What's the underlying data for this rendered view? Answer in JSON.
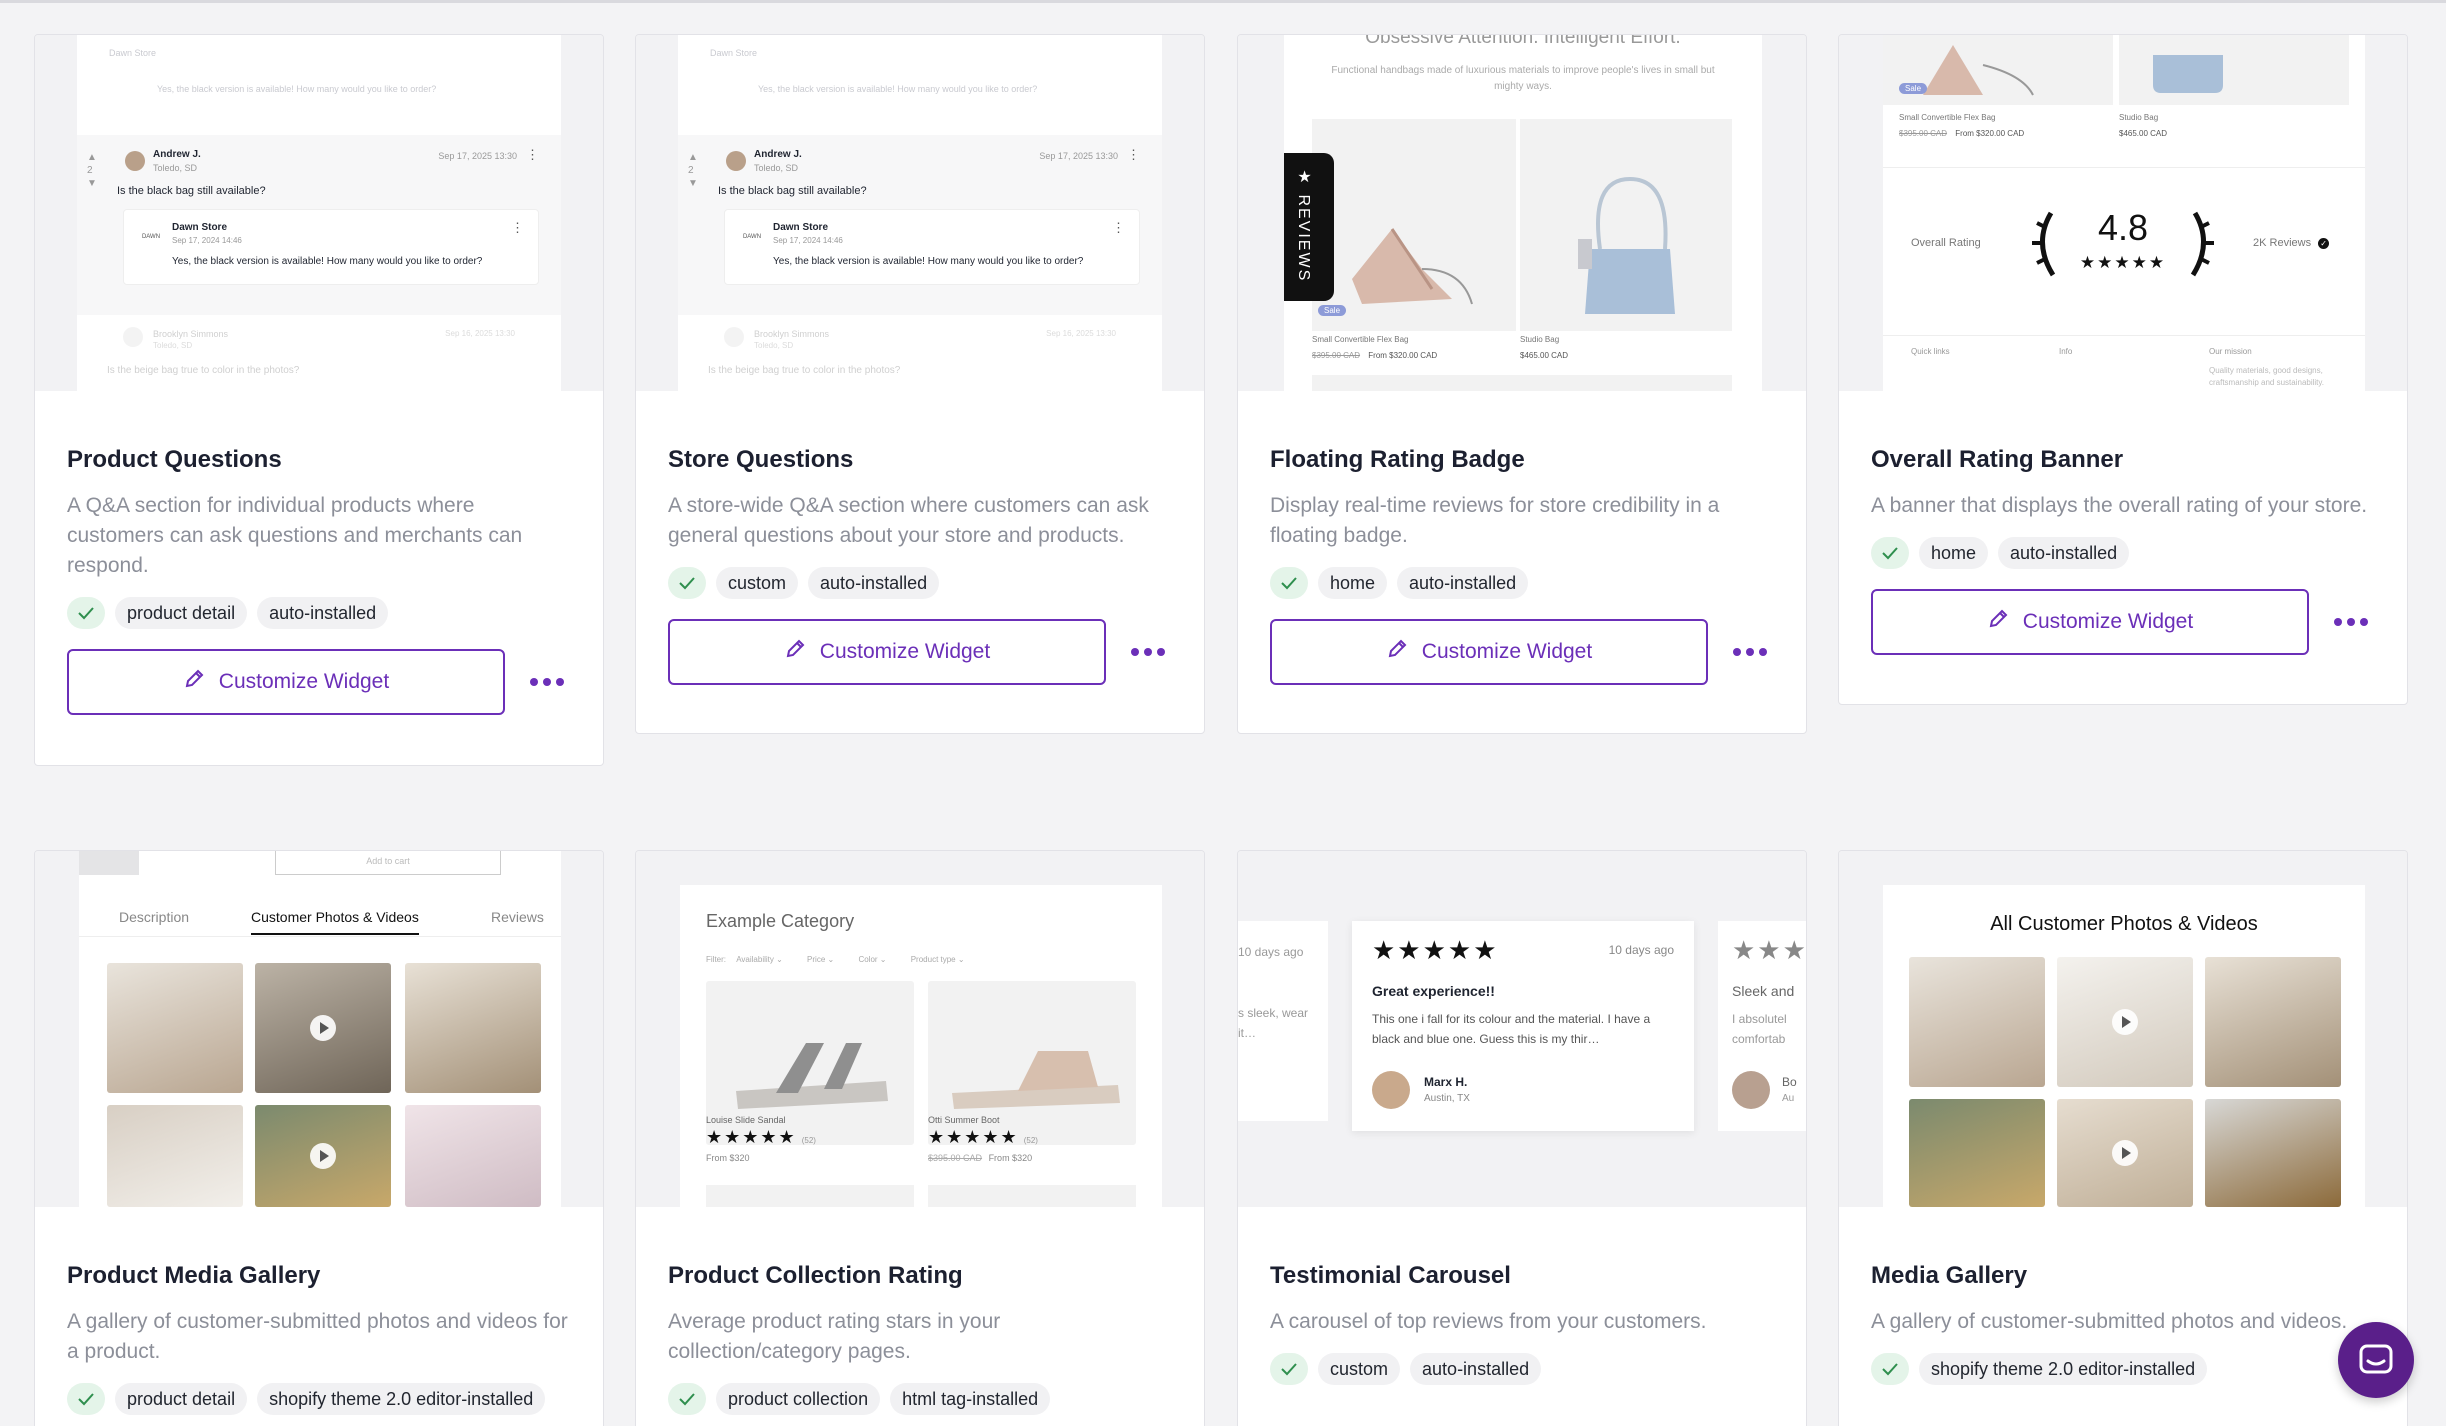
{
  "colors": {
    "accent": "#6b2fb8",
    "check_bg": "#e4f4e9",
    "check": "#2f8f4e",
    "fab": "#5a1f8a"
  },
  "cards": [
    {
      "title": "Product Questions",
      "desc": "A Q&A section for individual products where customers can ask questions and merchants can respond.",
      "tags": [
        "product detail",
        "auto-installed"
      ],
      "button": "Customize Widget",
      "preview": {
        "top_name": "Dawn Store",
        "top_text": "Yes, the black version is available! How many would you like to order?",
        "q_author": "Andrew J.",
        "q_location": "Toledo, SD",
        "q_date": "Sep 17, 2025 13:30",
        "q_text": "Is the black bag still available?",
        "vote_count": "2",
        "a_author": "Dawn Store",
        "a_date": "Sep 17, 2024 14:46",
        "a_text": "Yes, the black version is available! How many would you like to order?",
        "next_author": "Brooklyn Simmons",
        "next_location": "Toledo, SD",
        "next_date": "Sep 16, 2025 13:30",
        "next_text": "Is the beige bag true to color in the photos?"
      }
    },
    {
      "title": "Store Questions",
      "desc": "A store-wide Q&A section where customers can ask general questions about your store and products.",
      "tags": [
        "custom",
        "auto-installed"
      ],
      "button": "Customize Widget",
      "preview": {
        "top_name": "Dawn Store",
        "top_text": "Yes, the black version is available! How many would you like to order?",
        "q_author": "Andrew J.",
        "q_location": "Toledo, SD",
        "q_date": "Sep 17, 2025 13:30",
        "q_text": "Is the black bag still available?",
        "vote_count": "2",
        "a_author": "Dawn Store",
        "a_date": "Sep 17, 2024 14:46",
        "a_text": "Yes, the black version is available! How many would you like to order?",
        "next_author": "Brooklyn Simmons",
        "next_location": "Toledo, SD",
        "next_date": "Sep 16, 2025 13:30",
        "next_text": "Is the beige bag true to color in the photos?"
      }
    },
    {
      "title": "Floating Rating Badge",
      "desc": "Display real-time reviews for store credibility in a floating badge.",
      "tags": [
        "home",
        "auto-installed"
      ],
      "button": "Customize Widget",
      "preview": {
        "heading": "Obsessive Attention. Intelligent Effort.",
        "sub": "Functional handbags made of luxurious materials to improve people's lives in small but mighty ways.",
        "badge": "REVIEWS",
        "sale": "Sale",
        "p1_name": "Small Convertible Flex Bag",
        "p1_old": "$395.00 CAD",
        "p1_price": "From $320.00 CAD",
        "p2_name": "Studio Bag",
        "p2_price": "$465.00 CAD"
      }
    },
    {
      "title": "Overall Rating Banner",
      "desc": "A banner that displays the overall rating of your store.",
      "tags": [
        "home",
        "auto-installed"
      ],
      "button": "Customize Widget",
      "preview": {
        "sale": "Sale",
        "p1_name": "Small Convertible Flex Bag",
        "p1_old": "$395.00 CAD",
        "p1_price": "From $320.00 CAD",
        "p2_name": "Studio Bag",
        "p2_price": "$465.00 CAD",
        "overall_label": "Overall Rating",
        "rating": "4.8",
        "stars": "★★★★★",
        "reviews": "2K Reviews",
        "footer_1": "Quick links",
        "footer_2": "Info",
        "footer_3": "Our mission",
        "footer_text": "Quality materials, good designs, craftsmanship and sustainability."
      }
    },
    {
      "title": "Product Media Gallery",
      "desc": "A gallery of customer-submitted photos and videos for a product.",
      "tags": [
        "product detail",
        "shopify theme 2.0 editor-installed"
      ],
      "button": "Customize Widget",
      "preview": {
        "add_to_cart": "Add to cart",
        "tabs": [
          "Description",
          "Customer Photos & Videos",
          "Reviews"
        ]
      }
    },
    {
      "title": "Product Collection Rating",
      "desc": "Average product rating stars in your collection/category pages.",
      "tags": [
        "product collection",
        "html tag-installed"
      ],
      "button": "Customize Widget",
      "preview": {
        "heading": "Example Category",
        "filters": [
          "Filter:",
          "Availability ⌄",
          "Price ⌄",
          "Color ⌄",
          "Product type ⌄"
        ],
        "p1_name": "Louise Slide Sandal",
        "p1_stars": "★★★★★",
        "p1_count": "(52)",
        "p1_price": "From $320",
        "p2_name": "Otti Summer Boot",
        "p2_stars": "★★★★★",
        "p2_count": "(52)",
        "p2_old": "$395.00 CAD",
        "p2_price": "From $320"
      }
    },
    {
      "title": "Testimonial Carousel",
      "desc": "A carousel of top reviews from your customers.",
      "tags": [
        "custom",
        "auto-installed"
      ],
      "button": "Customize Widget",
      "preview": {
        "left_date": "10 days ago",
        "left_text": "s sleek, wear it…",
        "stars": "★★★★★",
        "date": "10 days ago",
        "title": "Great experience!!",
        "text": "This one i fall for its colour and the material. I have a black and blue one. Guess this is my thir…",
        "author": "Marx H.",
        "location": "Austin, TX",
        "right_stars": "★★★",
        "right_title": "Sleek and",
        "right_text": "I absolutel comfortab",
        "right_author": "Bo",
        "right_location": "Au"
      }
    },
    {
      "title": "Media Gallery",
      "desc": "A gallery of customer-submitted photos and videos.",
      "tags": [
        "shopify theme 2.0 editor-installed"
      ],
      "button": "Customize Widget",
      "preview": {
        "heading": "All Customer Photos & Videos"
      }
    }
  ]
}
